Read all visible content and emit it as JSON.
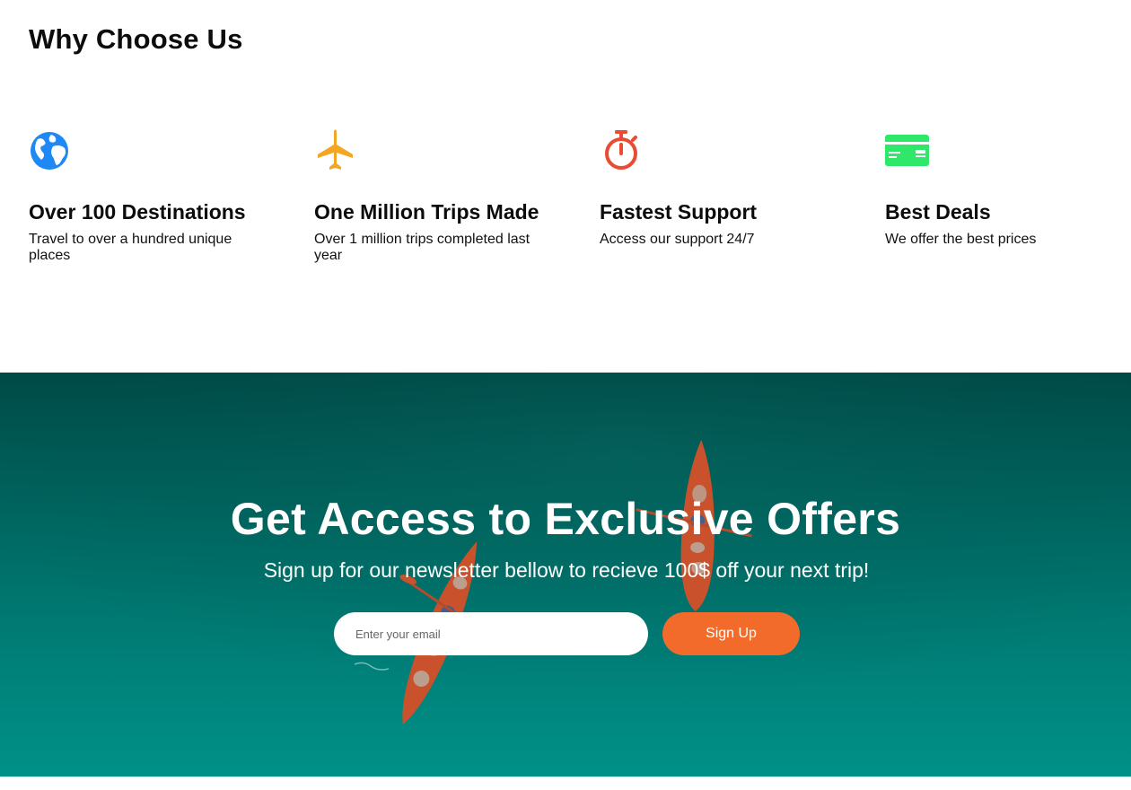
{
  "why_section": {
    "title": "Why Choose Us",
    "features": [
      {
        "icon": "globe-icon",
        "color": "#1e88f5",
        "title": "Over 100 Destinations",
        "text": "Travel to over a hundred unique places"
      },
      {
        "icon": "airplane-icon",
        "color": "#f5a524",
        "title": "One Million Trips Made",
        "text": "Over 1 million trips completed last year"
      },
      {
        "icon": "stopwatch-icon",
        "color": "#ea4b35",
        "title": "Fastest Support",
        "text": "Access our support 24/7"
      },
      {
        "icon": "credit-card-icon",
        "color": "#2fe86a",
        "title": "Best Deals",
        "text": "We offer the best prices"
      }
    ]
  },
  "newsletter": {
    "title": "Get Access to Exclusive Offers",
    "subtitle": "Sign up for our newsletter bellow to recieve 100$ off your next trip!",
    "email_placeholder": "Enter your email",
    "button_label": "Sign Up",
    "button_color": "#f26b2b",
    "background_color": "#007a73"
  }
}
